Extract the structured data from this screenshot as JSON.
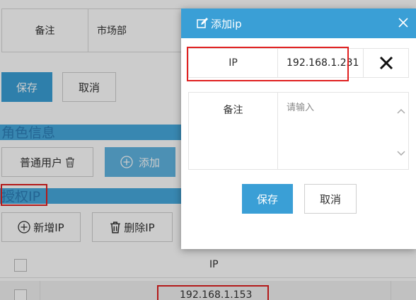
{
  "background": {
    "remark_label": "备注",
    "remark_value": "市场部",
    "save_label": "保存",
    "cancel_label": "取消",
    "role_section_title": "角色信息",
    "role_chip_label": "普通用户",
    "add_label": "添加",
    "auth_section_title": "授权IP",
    "new_ip_label": "新增IP",
    "delete_ip_label": "删除IP",
    "table": {
      "header": "IP",
      "rows": [
        {
          "ip": "192.168.1.153"
        }
      ]
    }
  },
  "dialog": {
    "title": "添加ip",
    "ip_label": "IP",
    "ip_value": "192.168.1.231",
    "remark_label": "备注",
    "remark_placeholder": "请输入",
    "save_label": "保存",
    "cancel_label": "取消"
  },
  "colors": {
    "accent": "#3a9fd6",
    "highlight": "#e02020"
  }
}
